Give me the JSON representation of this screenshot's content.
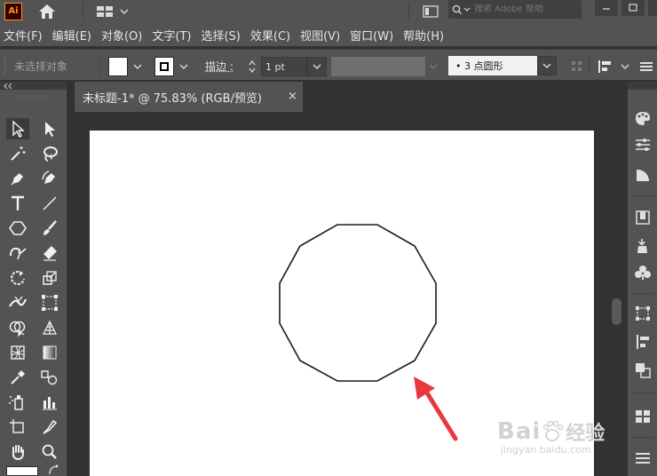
{
  "app": {
    "logo_text": "Ai"
  },
  "titlebar": {
    "search_placeholder": "搜索 Adobe 帮助"
  },
  "menubar": {
    "items": [
      "文件(F)",
      "编辑(E)",
      "对象(O)",
      "文字(T)",
      "选择(S)",
      "效果(C)",
      "视图(V)",
      "窗口(W)",
      "帮助(H)"
    ]
  },
  "controlbar": {
    "selection_status": "未选择对象",
    "stroke_label": "描边 :",
    "stroke_weight": "1 pt",
    "brush_profile": "• 3 点圆形"
  },
  "document": {
    "tab_title": "未标题-1* @ 75.83% (RGB/预览)",
    "close_glyph": "×"
  },
  "watermark": {
    "brand": "Bai",
    "brand_suffix": "经验",
    "url": "jingyan.baidu.com"
  },
  "colors": {
    "chrome": "#535353",
    "dark": "#323232",
    "artboard": "#ffffff",
    "shape_stroke": "#1a1a1a",
    "arrow": "#e8383d",
    "accent_orange": "#ff9a00"
  }
}
